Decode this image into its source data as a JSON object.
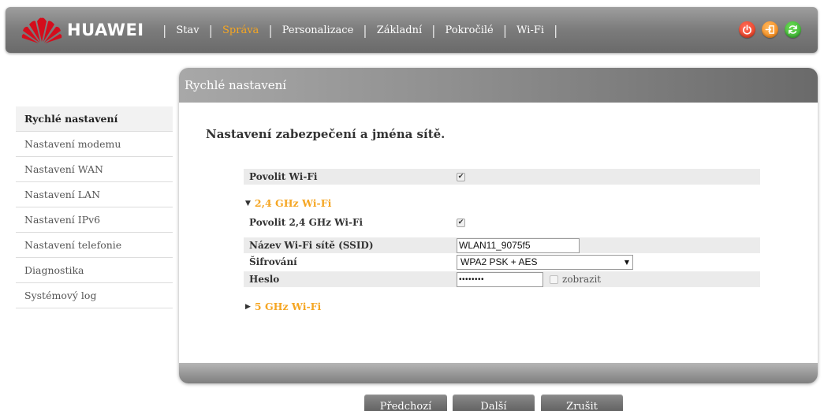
{
  "brand": {
    "name": "HUAWEI"
  },
  "nav": {
    "items": [
      {
        "label": "Stav",
        "active": false
      },
      {
        "label": "Správa",
        "active": true
      },
      {
        "label": "Personalizace",
        "active": false
      },
      {
        "label": "Základní",
        "active": false
      },
      {
        "label": "Pokročilé",
        "active": false
      },
      {
        "label": "Wi-Fi",
        "active": false
      }
    ],
    "separator": "|",
    "active_color": "#f5a623",
    "icons": [
      "power-icon",
      "logout-icon",
      "refresh-icon"
    ]
  },
  "sidebar": {
    "items": [
      {
        "label": "Rychlé nastavení",
        "active": true
      },
      {
        "label": "Nastavení modemu",
        "active": false
      },
      {
        "label": "Nastavení WAN",
        "active": false
      },
      {
        "label": "Nastavení LAN",
        "active": false
      },
      {
        "label": "Nastavení IPv6",
        "active": false
      },
      {
        "label": "Nastavení telefonie",
        "active": false
      },
      {
        "label": "Diagnostika",
        "active": false
      },
      {
        "label": "Systémový log",
        "active": false
      }
    ]
  },
  "panel": {
    "title": "Rychlé nastavení",
    "section_title": "Nastavení zabezpečení a jména sítě.",
    "enable_wifi": {
      "label": "Povolit Wi-Fi",
      "checked": true
    },
    "group_24": {
      "label": "2,4 GHz Wi-Fi",
      "expanded": true,
      "enable": {
        "label": "Povolit 2,4 GHz Wi-Fi",
        "checked": true
      },
      "ssid": {
        "label": "Název Wi-Fi sítě (SSID)",
        "value": "WLAN11_9075f5"
      },
      "encryption": {
        "label": "Šifrování",
        "value": "WPA2 PSK + AES"
      },
      "password": {
        "label": "Heslo",
        "value": "••••••••",
        "show_label": "zobrazit",
        "show_checked": false
      }
    },
    "group_5": {
      "label": "5 GHz Wi-Fi",
      "expanded": false
    }
  },
  "buttons": {
    "prev": "Předchozí",
    "next": "Další",
    "cancel": "Zrušit"
  }
}
